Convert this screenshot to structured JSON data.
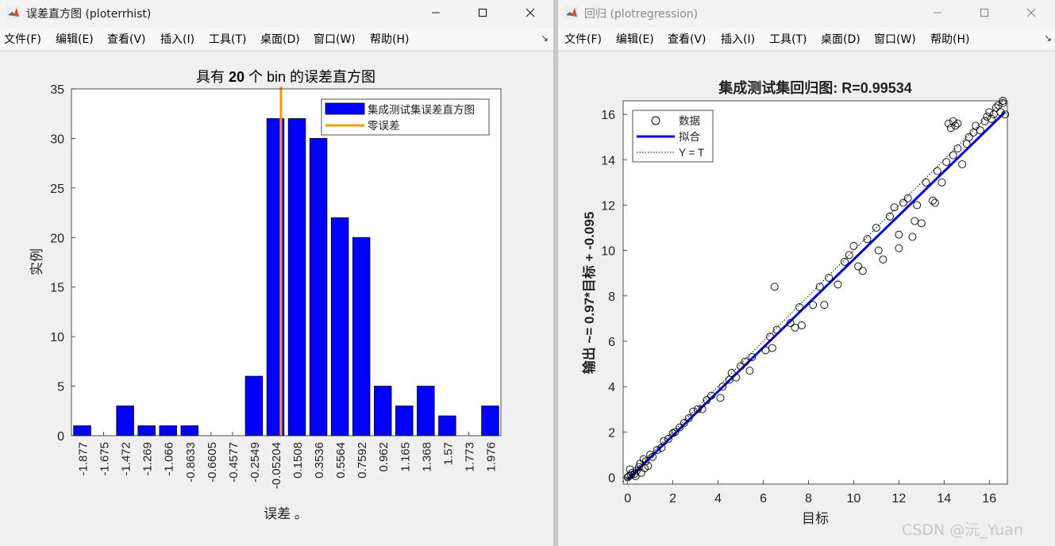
{
  "window_left": {
    "title": "误差直方图 (ploterrhist)",
    "menu": [
      "文件(F)",
      "编辑(E)",
      "查看(V)",
      "插入(I)",
      "工具(T)",
      "桌面(D)",
      "窗口(W)",
      "帮助(H)"
    ],
    "dock_glyph": "↘"
  },
  "window_right": {
    "title": "回归 (plotregression)",
    "menu": [
      "文件(F)",
      "编辑(E)",
      "查看(V)",
      "插入(I)",
      "工具(T)",
      "桌面(D)",
      "窗口(W)",
      "帮助(H)"
    ],
    "dock_glyph": "↘"
  },
  "colors": {
    "bar": "#0000ff",
    "zero_line": "#f39c12",
    "fit_line": "#0000dd"
  },
  "chart_data": [
    {
      "type": "bar",
      "title": "具有 20 个 bin 的误差直方图",
      "title_number": "20",
      "xlabel": "误差 。",
      "ylabel": "实例",
      "ylim": [
        0,
        35
      ],
      "yticks": [
        0,
        5,
        10,
        15,
        20,
        25,
        30,
        35
      ],
      "categories": [
        "-1.877",
        "-1.675",
        "-1.472",
        "-1.269",
        "-1.066",
        "-0.8633",
        "-0.6605",
        "-0.4577",
        "-0.2549",
        "-0.05204",
        "0.1508",
        "0.3536",
        "0.5564",
        "0.7592",
        "0.962",
        "1.165",
        "1.368",
        "1.57",
        "1.773",
        "1.976"
      ],
      "values": [
        1,
        0,
        3,
        1,
        1,
        1,
        0,
        0,
        6,
        32,
        32,
        30,
        22,
        20,
        5,
        3,
        5,
        2,
        0,
        3
      ],
      "zero_error_x": 0,
      "legend": {
        "position": "top-right",
        "entries": [
          "集成测试集误差直方图",
          "零误差"
        ]
      }
    },
    {
      "type": "scatter",
      "title": "集成测试集回归图: R=0.99534",
      "xlabel": "目标",
      "ylabel": "输出 ~= 0.97*目标 + -0.095",
      "xlim": [
        -0.2,
        16.8
      ],
      "ylim": [
        -0.3,
        16.6
      ],
      "xticks": [
        0,
        2,
        4,
        6,
        8,
        10,
        12,
        14,
        16
      ],
      "yticks": [
        0,
        2,
        4,
        6,
        8,
        10,
        12,
        14,
        16
      ],
      "fit": {
        "slope": 0.97,
        "intercept": -0.095
      },
      "legend": {
        "position": "top-left",
        "entries": [
          "数据",
          "拟合",
          "Y = T"
        ]
      },
      "points": [
        [
          0,
          0
        ],
        [
          0.05,
          0.05
        ],
        [
          0.1,
          0.35
        ],
        [
          0.15,
          0.1
        ],
        [
          0.2,
          0.2
        ],
        [
          0.3,
          0.15
        ],
        [
          0.35,
          0.05
        ],
        [
          0.4,
          0.3
        ],
        [
          0.5,
          0.45
        ],
        [
          0.55,
          0.6
        ],
        [
          0.6,
          0.2
        ],
        [
          0.7,
          0.8
        ],
        [
          0.75,
          0.4
        ],
        [
          0.8,
          0.7
        ],
        [
          0.9,
          0.5
        ],
        [
          1.0,
          1.0
        ],
        [
          1.1,
          0.9
        ],
        [
          1.3,
          1.2
        ],
        [
          1.5,
          1.3
        ],
        [
          1.6,
          1.6
        ],
        [
          1.8,
          1.7
        ],
        [
          2.0,
          1.95
        ],
        [
          2.1,
          2.0
        ],
        [
          2.3,
          2.2
        ],
        [
          2.5,
          2.4
        ],
        [
          2.7,
          2.6
        ],
        [
          2.9,
          2.9
        ],
        [
          3.1,
          3.0
        ],
        [
          3.3,
          3.0
        ],
        [
          3.5,
          3.4
        ],
        [
          3.7,
          3.6
        ],
        [
          4.1,
          3.5
        ],
        [
          4.2,
          4.0
        ],
        [
          4.5,
          4.3
        ],
        [
          4.6,
          4.6
        ],
        [
          4.8,
          4.4
        ],
        [
          5.0,
          4.9
        ],
        [
          5.2,
          5.1
        ],
        [
          5.4,
          4.7
        ],
        [
          5.5,
          5.3
        ],
        [
          6.1,
          5.6
        ],
        [
          6.3,
          6.2
        ],
        [
          6.4,
          5.7
        ],
        [
          6.5,
          8.4
        ],
        [
          6.6,
          6.5
        ],
        [
          7.2,
          6.8
        ],
        [
          7.4,
          6.6
        ],
        [
          7.6,
          7.5
        ],
        [
          7.7,
          6.7
        ],
        [
          8.2,
          7.6
        ],
        [
          8.5,
          8.4
        ],
        [
          8.7,
          7.6
        ],
        [
          8.9,
          8.8
        ],
        [
          9.3,
          8.5
        ],
        [
          9.6,
          9.5
        ],
        [
          9.8,
          9.8
        ],
        [
          10.0,
          10.2
        ],
        [
          10.2,
          9.3
        ],
        [
          10.4,
          9.1
        ],
        [
          10.6,
          10.5
        ],
        [
          11.0,
          11.0
        ],
        [
          11.1,
          10.0
        ],
        [
          11.3,
          9.6
        ],
        [
          11.6,
          11.5
        ],
        [
          11.8,
          11.9
        ],
        [
          12.0,
          10.1
        ],
        [
          12.0,
          10.7
        ],
        [
          12.2,
          12.1
        ],
        [
          12.4,
          12.3
        ],
        [
          12.6,
          10.6
        ],
        [
          12.7,
          11.3
        ],
        [
          12.8,
          12.0
        ],
        [
          13.0,
          11.2
        ],
        [
          13.2,
          13.0
        ],
        [
          13.5,
          12.2
        ],
        [
          13.6,
          12.1
        ],
        [
          13.7,
          13.5
        ],
        [
          13.9,
          13.0
        ],
        [
          14.1,
          13.9
        ],
        [
          14.2,
          15.6
        ],
        [
          14.3,
          15.4
        ],
        [
          14.4,
          15.7
        ],
        [
          14.5,
          15.5
        ],
        [
          14.6,
          15.6
        ],
        [
          14.4,
          14.2
        ],
        [
          14.6,
          14.5
        ],
        [
          14.8,
          13.8
        ],
        [
          15.0,
          14.7
        ],
        [
          15.1,
          15.0
        ],
        [
          15.3,
          15.2
        ],
        [
          15.4,
          15.5
        ],
        [
          15.6,
          15.3
        ],
        [
          15.8,
          15.7
        ],
        [
          15.9,
          15.9
        ],
        [
          16.0,
          16.1
        ],
        [
          16.1,
          15.8
        ],
        [
          16.2,
          16.0
        ],
        [
          16.3,
          16.3
        ],
        [
          16.4,
          16.4
        ],
        [
          16.5,
          16.1
        ],
        [
          16.6,
          16.5
        ],
        [
          16.7,
          16.0
        ],
        [
          16.6,
          16.6
        ]
      ]
    }
  ],
  "watermark": "CSDN @沅_Yuan"
}
